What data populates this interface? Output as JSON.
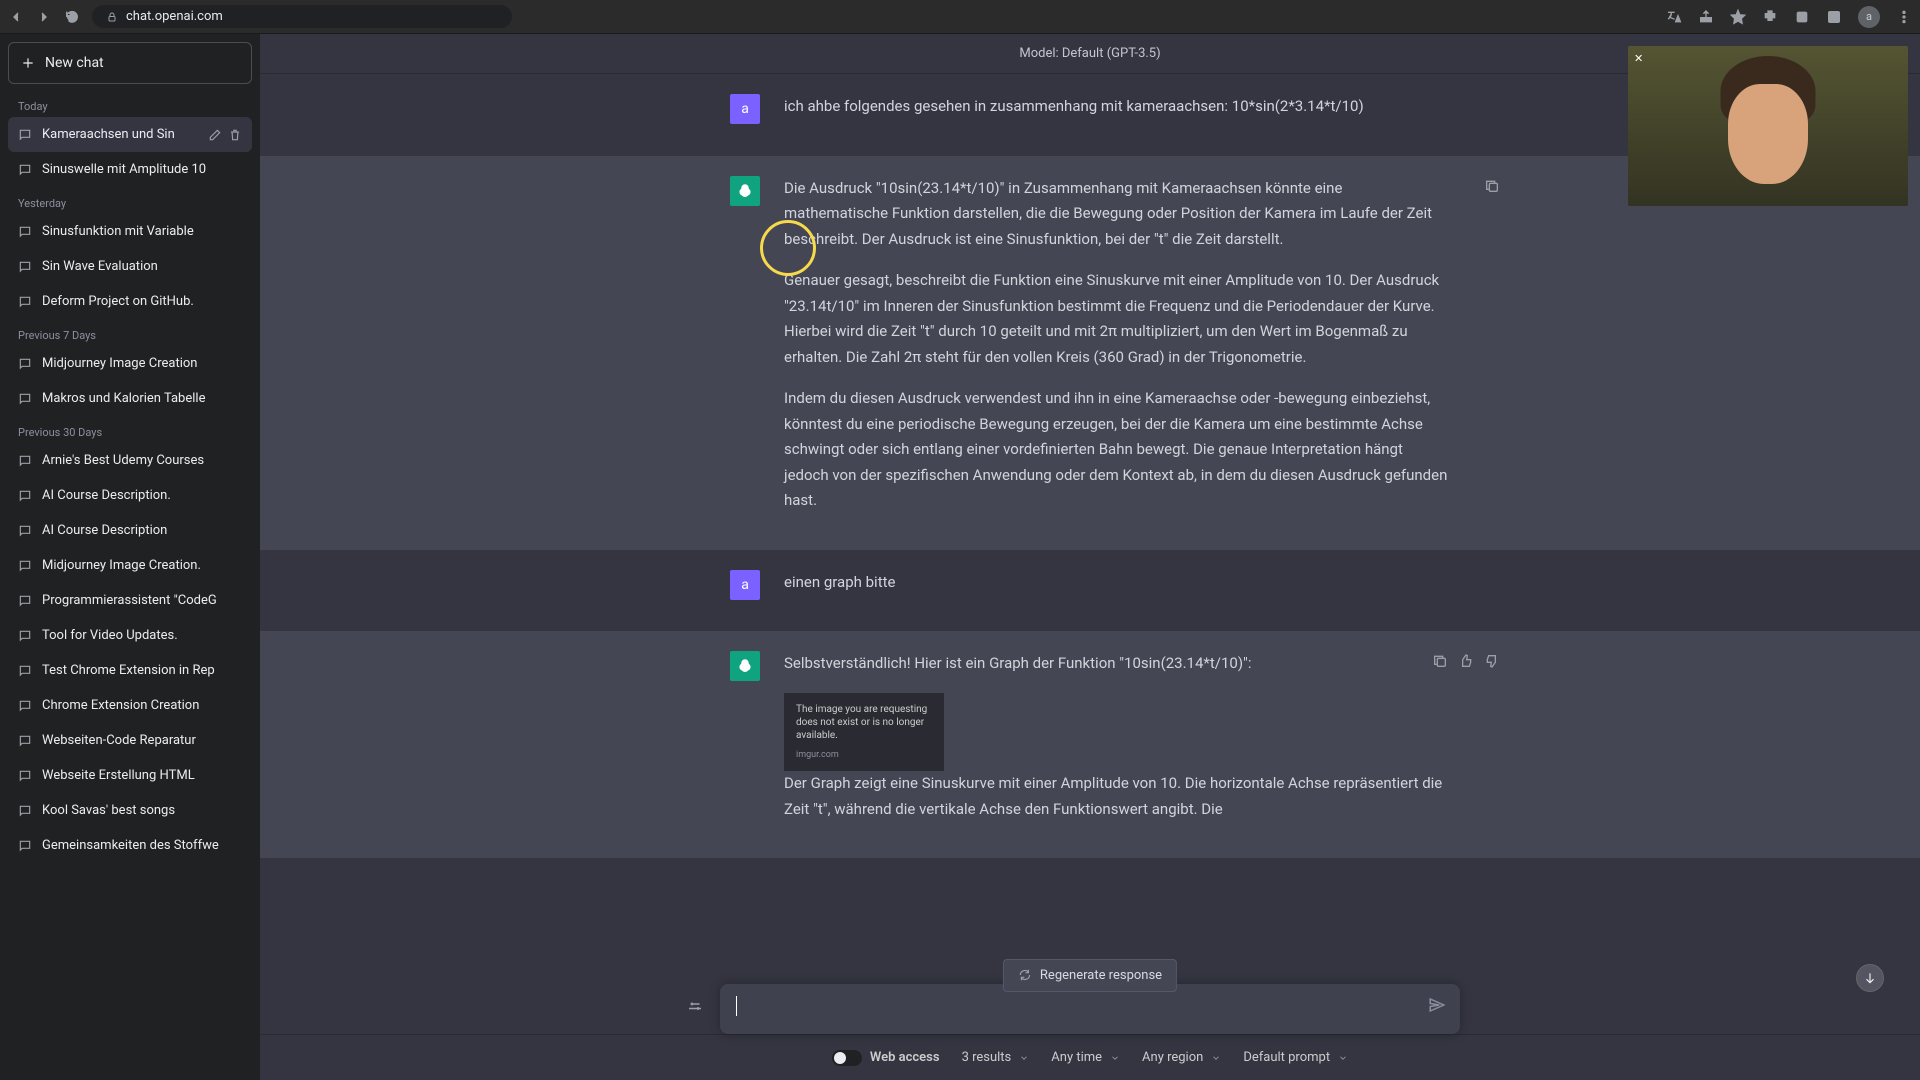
{
  "browser": {
    "url": "chat.openai.com",
    "avatar": "a"
  },
  "header": {
    "model": "Model: Default (GPT-3.5)"
  },
  "sidebar": {
    "new_chat": "New chat",
    "sections": [
      {
        "label": "Today",
        "items": [
          "Kameraachsen und Sin",
          "Sinuswelle mit Amplitude 10"
        ]
      },
      {
        "label": "Yesterday",
        "items": [
          "Sinusfunktion mit Variable",
          "Sin Wave Evaluation",
          "Deform Project on GitHub."
        ]
      },
      {
        "label": "Previous 7 Days",
        "items": [
          "Midjourney Image Creation",
          "Makros und Kalorien Tabelle"
        ]
      },
      {
        "label": "Previous 30 Days",
        "items": [
          "Arnie's Best Udemy Courses",
          "AI Course Description.",
          "AI Course Description",
          "Midjourney Image Creation.",
          "Programmierassistent \"CodeG",
          "Tool for Video Updates.",
          "Test Chrome Extension in Rep",
          "Chrome Extension Creation",
          "Webseiten-Code Reparatur",
          "Webseite Erstellung HTML",
          "Kool Savas' best songs",
          "Gemeinsamkeiten des Stoffwe"
        ]
      }
    ]
  },
  "messages": [
    {
      "role": "user",
      "avatar": "a",
      "paragraphs": [
        "ich ahbe folgendes gesehen in zusammenhang mit kameraachsen: 10*sin(2*3.14*t/10)"
      ]
    },
    {
      "role": "ai",
      "paragraphs": [
        "Die Ausdruck \"10sin(23.14*t/10)\" in Zusammenhang mit Kameraachsen könnte eine mathematische Funktion darstellen, die die Bewegung oder Position der Kamera im Laufe der Zeit beschreibt. Der Ausdruck ist eine Sinusfunktion, bei der \"t\" die Zeit darstellt.",
        "Genauer gesagt, beschreibt die Funktion eine Sinuskurve mit einer Amplitude von 10. Der Ausdruck \"23.14t/10\" im Inneren der Sinusfunktion bestimmt die Frequenz und die Periodendauer der Kurve. Hierbei wird die Zeit \"t\" durch 10 geteilt und mit 2π multipliziert, um den Wert im Bogenmaß zu erhalten. Die Zahl 2π steht für den vollen Kreis (360 Grad) in der Trigonometrie.",
        "Indem du diesen Ausdruck verwendest und ihn in eine Kameraachse oder -bewegung einbeziehst, könntest du eine periodische Bewegung erzeugen, bei der die Kamera um eine bestimmte Achse schwingt oder sich entlang einer vordefinierten Bahn bewegt. Die genaue Interpretation hängt jedoch von der spezifischen Anwendung oder dem Kontext ab, in dem du diesen Ausdruck gefunden hast."
      ]
    },
    {
      "role": "user",
      "avatar": "a",
      "paragraphs": [
        "einen graph bitte"
      ]
    },
    {
      "role": "ai",
      "paragraphs": [
        "Selbstverständlich! Hier ist ein Graph der Funktion \"10sin(23.14*t/10)\":",
        "",
        "Der Graph zeigt eine Sinuskurve mit einer Amplitude von 10. Die horizontale Achse repräsentiert die Zeit \"t\", während die vertikale Achse den Funktionswert angibt. Die"
      ],
      "image_err": {
        "text": "The image you are requesting does not exist or is no longer available.",
        "host": "imgur.com"
      }
    }
  ],
  "regen": "Regenerate response",
  "bottom": {
    "web_access": "Web access",
    "results": "3 results",
    "time": "Any time",
    "region": "Any region",
    "prompt": "Default prompt"
  }
}
